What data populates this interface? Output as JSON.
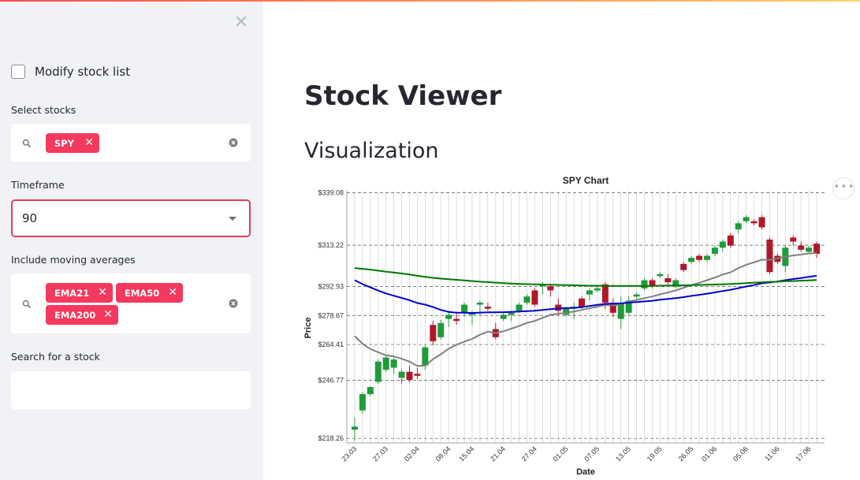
{
  "sidebar": {
    "close_icon": "close-icon",
    "modify_label": "Modify stock list",
    "select_stocks_label": "Select stocks",
    "selected_stocks": [
      "SPY"
    ],
    "timeframe_label": "Timeframe",
    "timeframe_value": "90",
    "ma_label": "Include moving averages",
    "moving_averages": [
      "EMA21",
      "EMA50",
      "EMA200"
    ],
    "search_label": "Search for a stock",
    "search_value": ""
  },
  "main": {
    "title": "Stock Viewer",
    "section": "Visualization",
    "more_label": "•••"
  },
  "colors": {
    "accent": "#f5385d",
    "up": "#1f9b3a",
    "down": "#b0182a",
    "ema21": "#808080",
    "ema50": "#0000cc",
    "ema200": "#007700"
  },
  "chart_data": {
    "type": "candlestick",
    "title": "SPY Chart",
    "xlabel": "Date",
    "ylabel": "Price",
    "ylim": [
      216,
      340
    ],
    "yticks": [
      218.26,
      246.77,
      264.41,
      278.67,
      292.93,
      313.22,
      339.08
    ],
    "ytick_labels": [
      "$218.26",
      "$246.77",
      "$264.41",
      "$278.67",
      "$292.93",
      "$313.22",
      "$339.08"
    ],
    "xtick_labels": [
      "23.03",
      "27.03",
      "02.04",
      "08.04",
      "15.04",
      "21.04",
      "27.04",
      "01.05",
      "07.05",
      "13.05",
      "19.05",
      "26.05",
      "01.06",
      "05.06",
      "11.06",
      "17.06"
    ],
    "grid": true,
    "candles": [
      [
        222.5,
        224,
        217,
        228.5
      ],
      [
        232,
        240,
        230.5,
        241
      ],
      [
        240,
        243.5,
        239,
        244
      ],
      [
        246,
        256,
        245,
        257
      ],
      [
        252,
        258,
        251,
        259
      ],
      [
        253,
        257,
        250,
        258
      ],
      [
        248,
        251,
        245,
        252
      ],
      [
        251,
        247,
        246,
        254
      ],
      [
        250,
        249,
        247.5,
        253
      ],
      [
        254,
        263,
        252,
        264
      ],
      [
        274,
        266,
        264,
        276
      ],
      [
        268,
        275,
        267,
        276.5
      ],
      [
        277,
        279,
        273,
        281
      ],
      [
        277,
        276,
        274,
        280
      ],
      [
        280,
        284,
        278,
        285
      ],
      [
        279,
        280,
        274,
        281
      ],
      [
        284,
        285,
        279,
        286
      ],
      [
        283,
        282,
        281,
        285
      ],
      [
        272,
        268,
        267,
        275
      ],
      [
        277,
        279,
        276,
        280
      ],
      [
        279,
        280,
        276,
        281
      ],
      [
        281,
        284,
        280,
        285
      ],
      [
        285,
        288,
        284,
        289
      ],
      [
        291,
        284,
        283,
        292
      ],
      [
        293,
        294,
        289,
        295
      ],
      [
        293,
        291,
        288,
        294
      ],
      [
        284,
        281,
        279,
        287
      ],
      [
        279,
        282,
        278,
        283
      ],
      [
        282,
        283,
        277,
        285
      ],
      [
        287,
        283,
        282,
        288
      ],
      [
        289,
        291,
        286,
        292
      ],
      [
        291,
        292,
        290,
        293
      ],
      [
        294,
        285,
        282,
        295
      ],
      [
        285,
        280,
        278,
        287
      ],
      [
        277,
        285,
        272,
        288
      ],
      [
        280,
        286,
        279,
        288
      ],
      [
        288,
        289,
        287,
        290
      ],
      [
        292,
        296,
        291,
        297
      ],
      [
        296,
        293,
        292,
        297
      ],
      [
        298,
        299,
        297,
        300
      ],
      [
        297,
        295,
        294,
        299
      ],
      [
        293,
        296,
        292,
        297
      ],
      [
        304,
        301,
        300,
        305
      ],
      [
        305,
        307,
        304,
        308
      ],
      [
        308,
        306,
        305,
        309
      ],
      [
        306,
        308,
        305,
        309
      ],
      [
        309,
        312,
        308,
        313
      ],
      [
        312,
        315,
        310,
        316
      ],
      [
        318,
        313,
        312,
        319
      ],
      [
        321,
        324,
        319,
        325
      ],
      [
        325,
        327,
        324,
        328
      ],
      [
        325,
        324,
        323,
        326
      ],
      [
        327,
        322,
        321,
        328
      ],
      [
        316,
        300,
        299,
        317
      ],
      [
        308,
        305,
        304,
        309
      ],
      [
        303,
        312,
        300,
        313
      ],
      [
        317,
        315,
        313,
        318
      ],
      [
        313,
        311,
        310,
        315
      ],
      [
        310,
        312,
        309,
        313
      ],
      [
        314,
        309,
        307,
        315
      ]
    ],
    "series": [
      {
        "name": "EMA21",
        "values": [
          268.5,
          264.8,
          262.2,
          260.6,
          259.1,
          258.6,
          257.4,
          256.0,
          253.9,
          254.0,
          257.2,
          259.6,
          262.4,
          264.3,
          265.8,
          267.2,
          269.2,
          270.7,
          270.0,
          270.9,
          272.2,
          273.5,
          275.0,
          276.0,
          277.5,
          279.0,
          279.5,
          280.0,
          280.6,
          281.4,
          282.2,
          283.0,
          283.8,
          283.6,
          284.2,
          285.5,
          286.3,
          287.2,
          288.0,
          289.1,
          290.0,
          291.0,
          292.3,
          293.6,
          294.7,
          296.0,
          297.3,
          298.8,
          299.9,
          302.0,
          303.6,
          304.8,
          306.1,
          306.0,
          306.8,
          307.6,
          308.2,
          308.6,
          309.2,
          309.4
        ]
      },
      {
        "name": "EMA50",
        "values": [
          296.0,
          294.1,
          292.5,
          290.9,
          289.5,
          288.4,
          287.3,
          286.2,
          284.8,
          284.0,
          282.8,
          281.4,
          280.4,
          280.0,
          280.0,
          279.9,
          280.1,
          280.2,
          280.2,
          280.3,
          280.4,
          280.6,
          280.8,
          281.0,
          281.4,
          281.8,
          282.1,
          282.3,
          282.4,
          282.8,
          283.3,
          283.9,
          284.4,
          284.5,
          284.6,
          285.0,
          285.3,
          285.6,
          285.9,
          286.4,
          286.8,
          287.2,
          287.7,
          288.3,
          288.8,
          289.4,
          290.0,
          290.7,
          291.3,
          292.1,
          292.9,
          293.6,
          294.5,
          294.9,
          295.4,
          296.0,
          296.6,
          297.1,
          297.7,
          298.2
        ]
      },
      {
        "name": "EMA200",
        "values": [
          302.0,
          301.6,
          301.2,
          300.7,
          300.2,
          299.8,
          299.3,
          298.8,
          298.2,
          297.7,
          297.2,
          296.8,
          296.5,
          296.2,
          295.9,
          295.6,
          295.3,
          295.1,
          294.8,
          294.6,
          294.4,
          294.2,
          294.1,
          294.0,
          293.9,
          293.8,
          293.7,
          293.6,
          293.5,
          293.4,
          293.3,
          293.3,
          293.2,
          293.2,
          293.2,
          293.2,
          293.2,
          293.2,
          293.2,
          293.3,
          293.4,
          293.4,
          293.5,
          293.6,
          293.7,
          293.8,
          293.9,
          294.0,
          294.2,
          294.4,
          294.6,
          294.8,
          295.0,
          295.2,
          295.3,
          295.5,
          295.6,
          295.8,
          295.9,
          296.1
        ]
      }
    ]
  }
}
